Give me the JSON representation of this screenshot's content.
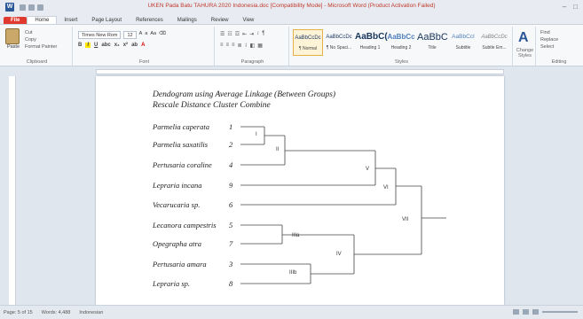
{
  "window": {
    "title": "UKEN Pada Batu TAHURA 2020 Indonesia.doc [Compatibility Mode] - Microsoft Word (Product Activation Failed)"
  },
  "tabs": [
    "File",
    "Home",
    "Insert",
    "Page Layout",
    "References",
    "Mailings",
    "Review",
    "View"
  ],
  "ribbon": {
    "clipboard": {
      "paste": "Paste",
      "cut": "Cut",
      "copy": "Copy",
      "format_painter": "Format Painter",
      "label": "Clipboard"
    },
    "font": {
      "name": "Times New Rom",
      "size": "12",
      "label": "Font"
    },
    "paragraph": {
      "label": "Paragraph"
    },
    "styles": {
      "items": [
        {
          "sample": "AaBbCcDc",
          "name": "¶ Normal"
        },
        {
          "sample": "AaBbCcDc",
          "name": "¶ No Spaci..."
        },
        {
          "sample": "AaBbC(",
          "name": "Heading 1"
        },
        {
          "sample": "AaBbCc",
          "name": "Heading 2"
        },
        {
          "sample": "AaBbC",
          "name": "Title"
        },
        {
          "sample": "AaBbCcI",
          "name": "Subtitle"
        },
        {
          "sample": "AaBbCcDc",
          "name": "Subtle Em..."
        }
      ],
      "label": "Styles"
    },
    "change_styles": "Change Styles",
    "editing": {
      "find": "Find",
      "replace": "Replace",
      "select": "Select",
      "label": "Editing"
    }
  },
  "document": {
    "title_line1": "Dendogram using Average Linkage (Between Groups)",
    "title_line2": "Rescale Distance Cluster Combine",
    "species": [
      {
        "name": "Parmelia caperata",
        "num": "1"
      },
      {
        "name": "Parmelia saxatilis",
        "num": "2"
      },
      {
        "name": "Pertusaria coraline",
        "num": "4"
      },
      {
        "name": "Lepraria incana",
        "num": "9"
      },
      {
        "name": "Vecarucaria sp.",
        "num": "6"
      },
      {
        "name": "Lecanora campestris",
        "num": "5"
      },
      {
        "name": "Opegrapha atra",
        "num": "7"
      },
      {
        "name": "Pertusaria amara",
        "num": "3"
      },
      {
        "name": "Lepraria sp.",
        "num": "8"
      }
    ],
    "clusters": [
      "I",
      "II",
      "V",
      "VI",
      "VII",
      "IIIa",
      "IV",
      "IIIb"
    ]
  },
  "status": {
    "page": "Page: 5 of 15",
    "words": "Words: 4,488",
    "language": "Indonesian"
  }
}
